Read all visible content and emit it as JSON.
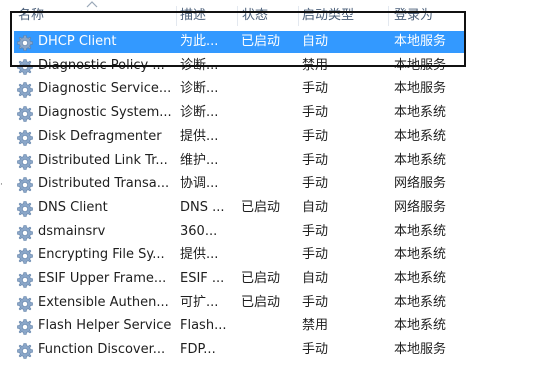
{
  "columns": {
    "name": "名称",
    "description": "描述",
    "status": "状态",
    "startup_type": "启动类型",
    "logon_as": "登录为"
  },
  "services": [
    {
      "name": "DHCP Client",
      "description": "为此...",
      "status": "已启动",
      "startup_type": "自动",
      "logon_as": "本地服务",
      "selected": true
    },
    {
      "name": "Diagnostic Policy ...",
      "description": "诊断...",
      "status": "",
      "startup_type": "禁用",
      "logon_as": "本地服务"
    },
    {
      "name": "Diagnostic Service...",
      "description": "诊断...",
      "status": "",
      "startup_type": "手动",
      "logon_as": "本地服务"
    },
    {
      "name": "Diagnostic System...",
      "description": "诊断...",
      "status": "",
      "startup_type": "手动",
      "logon_as": "本地系统"
    },
    {
      "name": "Disk Defragmenter",
      "description": "提供...",
      "status": "",
      "startup_type": "手动",
      "logon_as": "本地系统"
    },
    {
      "name": "Distributed Link Tr...",
      "description": "维护...",
      "status": "",
      "startup_type": "手动",
      "logon_as": "本地系统"
    },
    {
      "name": "Distributed Transa...",
      "description": "协调...",
      "status": "",
      "startup_type": "手动",
      "logon_as": "网络服务"
    },
    {
      "name": "DNS Client",
      "description": "DNS ...",
      "status": "已启动",
      "startup_type": "自动",
      "logon_as": "网络服务"
    },
    {
      "name": "dsmainsrv",
      "description": "360...",
      "status": "",
      "startup_type": "手动",
      "logon_as": "本地系统"
    },
    {
      "name": "Encrypting File Sy...",
      "description": "提供...",
      "status": "",
      "startup_type": "手动",
      "logon_as": "本地系统"
    },
    {
      "name": "ESIF Upper Frame...",
      "description": "ESIF ...",
      "status": "已启动",
      "startup_type": "自动",
      "logon_as": "本地系统"
    },
    {
      "name": "Extensible Authen...",
      "description": "可扩...",
      "status": "已启动",
      "startup_type": "手动",
      "logon_as": "本地系统"
    },
    {
      "name": "Flash Helper Service",
      "description": "Flash...",
      "status": "",
      "startup_type": "禁用",
      "logon_as": "本地系统"
    },
    {
      "name": "Function Discover...",
      "description": "FDP...",
      "status": "",
      "startup_type": "手动",
      "logon_as": "本地服务"
    }
  ],
  "icons": {
    "service": "gear-icon",
    "sort": "sort-ascending-icon"
  },
  "colors": {
    "selection": "#3399ff",
    "header_text": "#4c607a",
    "highlight_box": "#111111"
  }
}
